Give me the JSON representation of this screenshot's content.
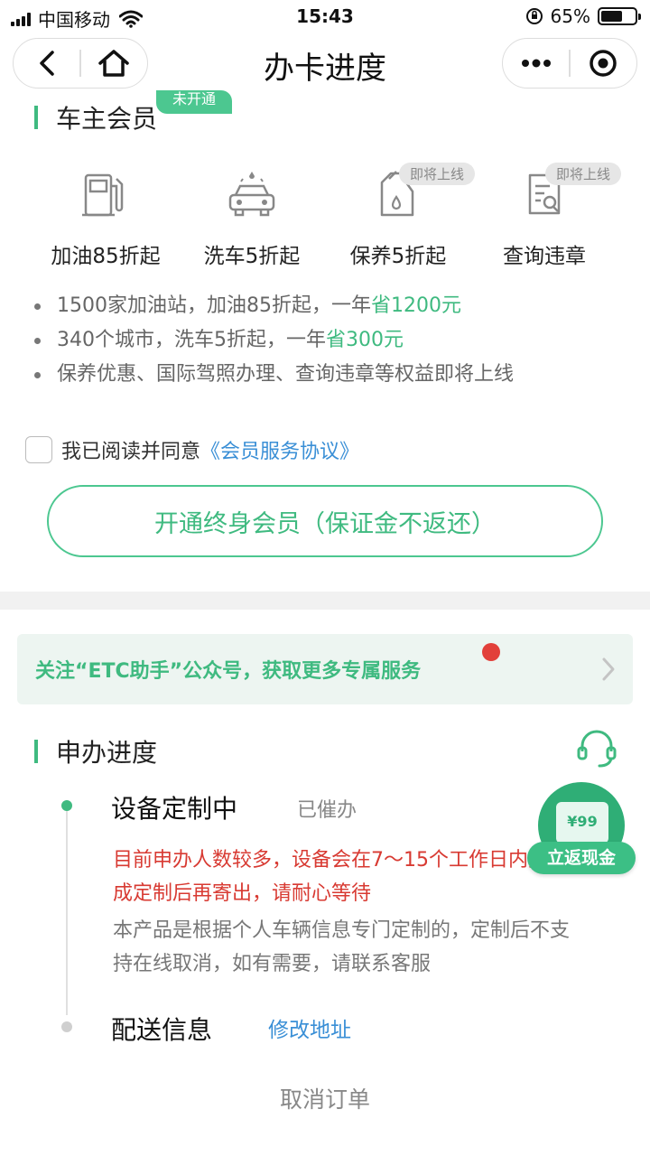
{
  "status_bar": {
    "carrier": "中国移动",
    "time": "15:43",
    "battery": "65%",
    "battery_level": 0.65
  },
  "nav": {
    "title": "办卡进度",
    "back_icon": "back-arrow-icon",
    "home_icon": "home-icon",
    "more_icon": "more-dots-icon",
    "close_icon": "target-close-icon"
  },
  "membership": {
    "title": "车主会员",
    "tag": "未开通",
    "benefits": [
      {
        "label": "加油85折起",
        "icon": "fuel-pump-icon",
        "badge": ""
      },
      {
        "label": "洗车5折起",
        "icon": "car-wash-icon",
        "badge": ""
      },
      {
        "label": "保养5折起",
        "icon": "oil-can-icon",
        "badge": "即将上线"
      },
      {
        "label": "查询违章",
        "icon": "search-document-icon",
        "badge": "即将上线"
      }
    ],
    "bullets": [
      {
        "text": "1500家加油站，加油85折起，一年",
        "highlight": "省1200元"
      },
      {
        "text": "340个城市，洗车5折起，一年",
        "highlight": "省300元"
      },
      {
        "text": "保养优惠、国际驾照办理、查询违章等权益即将上线",
        "highlight": ""
      }
    ],
    "agree_text": "我已阅读并同意",
    "agree_link": "《会员服务协议》",
    "open_button": "开通终身会员（保证金不返还）"
  },
  "follow_banner": {
    "text": "关注“ETC助手”公众号，获取更多专属服务"
  },
  "progress": {
    "title": "申办进度",
    "steps": [
      {
        "title": "设备定制中",
        "status": "已催办",
        "warning": "目前申办人数较多，设备会在7～15个工作日内完成定制后再寄出，请耐心等待",
        "note": "本产品是根据个人车辆信息专门定制的，定制后不支持在线取消，如有需要，请联系客服"
      },
      {
        "title": "配送信息",
        "link": "修改地址"
      }
    ],
    "cancel": "取消订单"
  },
  "floating_cashback": {
    "card_text": "¥99",
    "label": "立返现金"
  },
  "colors": {
    "accent": "#3fba80",
    "warning": "#d83a32",
    "link": "#3a8fd6"
  }
}
